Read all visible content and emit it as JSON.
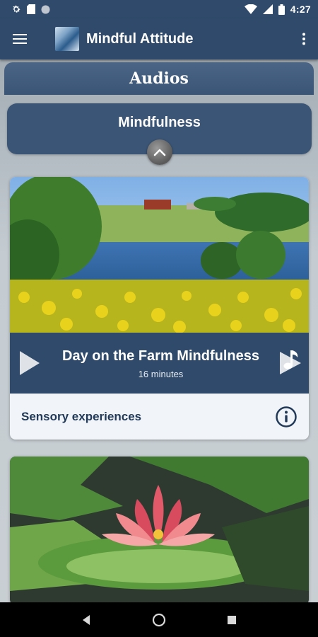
{
  "status_bar": {
    "time": "4:27",
    "icons": [
      "gear-icon",
      "sd-card-icon",
      "circle-icon",
      "wifi-icon",
      "signal-icon",
      "battery-icon"
    ]
  },
  "app_bar": {
    "title": "Mindful Attitude",
    "icons": [
      "menu-icon",
      "app-logo",
      "more-vert-icon"
    ]
  },
  "page": {
    "title": "Audios"
  },
  "category": {
    "title": "Mindfulness",
    "toggle_icon": "chevron-up-icon"
  },
  "tracks": [
    {
      "title": "Day on the Farm Mindfulness",
      "duration": "16 minutes",
      "subtitle": "Sensory experiences",
      "image": "farm-landscape",
      "icons": [
        "play-icon",
        "music-note-icon",
        "info-icon"
      ]
    },
    {
      "image": "water-lily"
    }
  ],
  "nav_bar": {
    "icons": [
      "back-icon",
      "home-icon",
      "recents-icon"
    ]
  },
  "colors": {
    "primary": "#2f4a6b",
    "header": "#3a5576",
    "card_footer": "#f1f5fa",
    "subtitle_text": "#223a58"
  }
}
